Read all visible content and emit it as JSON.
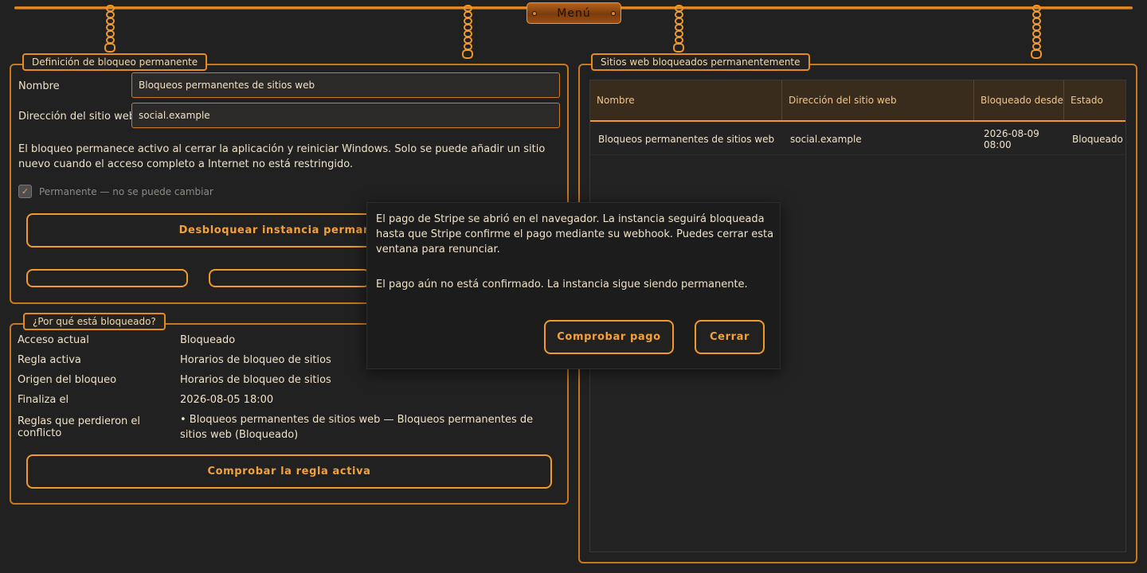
{
  "menu": {
    "label": "Menú"
  },
  "definition": {
    "legend": "Definición de bloqueo permanente",
    "name_label": "Nombre",
    "name_value": "Bloqueos permanentes de sitios web",
    "url_label": "Dirección del sitio web",
    "url_value": "social.example",
    "info": "El bloqueo permanece activo al cerrar la aplicación y reiniciar Windows. Solo se puede añadir un sitio nuevo cuando el acceso completo a Internet no está restringido.",
    "permanent_label": "Permanente — no se puede cambiar",
    "unblock_label": "Desbloquear instancia permanente"
  },
  "why": {
    "legend": "¿Por qué está bloqueado?",
    "rows": [
      {
        "key": "Acceso actual",
        "value": "Bloqueado"
      },
      {
        "key": "Regla activa",
        "value": "Horarios de bloqueo de sitios"
      },
      {
        "key": "Origen del bloqueo",
        "value": "Horarios de bloqueo de sitios"
      },
      {
        "key": "Finaliza el",
        "value": "2026-08-05 18:00"
      },
      {
        "key": "Reglas que perdieron el conflicto",
        "value": "• Bloqueos permanentes de sitios web — Bloqueos permanentes de sitios web (Bloqueado)"
      }
    ],
    "check_label": "Comprobar la regla activa"
  },
  "blocked_sites": {
    "legend": "Sitios web bloqueados permanentemente",
    "columns": [
      "Nombre",
      "Dirección del sitio web",
      "Bloqueado desde",
      "Estado"
    ],
    "rows": [
      [
        "Bloqueos permanentes de sitios web",
        "social.example",
        "2026-08-09 08:00",
        "Bloqueado"
      ]
    ]
  },
  "dialog": {
    "message": "El pago de Stripe se abrió en el navegador. La instancia seguirá bloqueada hasta que Stripe confirme el pago mediante su webhook. Puedes cerrar esta ventana para renunciar.",
    "status": "El pago aún no está confirmado. La instancia sigue siendo permanente.",
    "check_payment": "Comprobar pago",
    "close": "Cerrar"
  },
  "colors": {
    "accent": "#f09a2a",
    "background": "#212121",
    "text": "#efe2c8"
  }
}
